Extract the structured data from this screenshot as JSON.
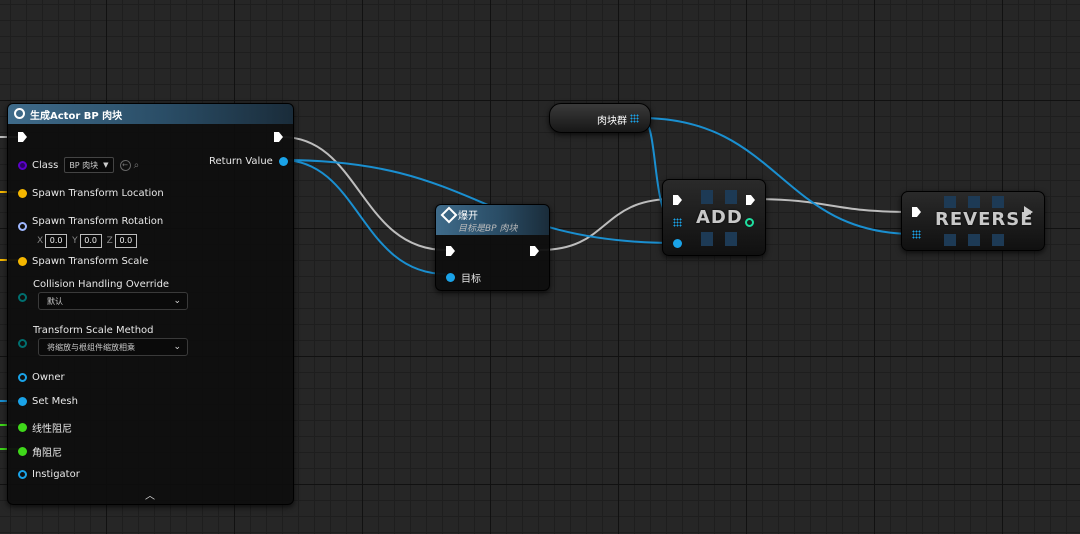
{
  "spawn_node": {
    "title": "生成Actor BP 肉块",
    "class_label": "Class",
    "class_value": "BP 肉块",
    "return_value_label": "Return Value",
    "spawn_location_label": "Spawn Transform Location",
    "spawn_rotation_label": "Spawn Transform Rotation",
    "rotation": {
      "x_label": "X",
      "x": "0.0",
      "y_label": "Y",
      "y": "0.0",
      "z_label": "Z",
      "z": "0.0"
    },
    "spawn_scale_label": "Spawn Transform Scale",
    "collision_label": "Collision Handling Override",
    "collision_value": "默认",
    "scale_method_label": "Transform Scale Method",
    "scale_method_value": "将缩放与根组件缩放相乘",
    "owner_label": "Owner",
    "set_mesh_label": "Set Mesh",
    "linear_damping_label": "线性阻尼",
    "angular_damping_label": "角阻尼",
    "instigator_label": "Instigator"
  },
  "explode_node": {
    "title": "爆开",
    "subtitle": "目标是BP 肉块",
    "target_label": "目标"
  },
  "variable_node": {
    "label": "肉块群"
  },
  "add_node": {
    "label": "ADD"
  },
  "reverse_node": {
    "label": "REVERSE"
  },
  "colors": {
    "exec": "#ffffff",
    "object": "#1aa3e8",
    "class": "#5b00c9",
    "vector": "#f5b700",
    "rotator": "#9fb8ff",
    "float": "#3fd81a",
    "byte": "#006f6f"
  }
}
